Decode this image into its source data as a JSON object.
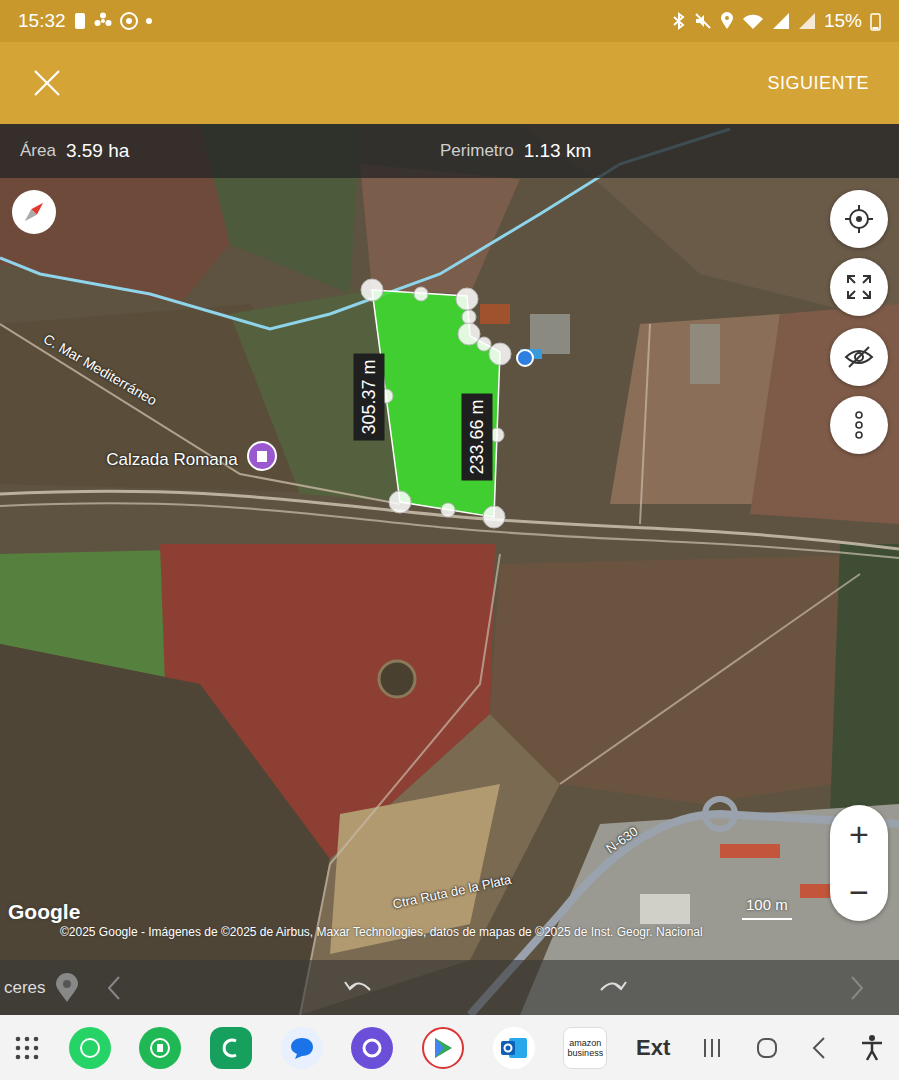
{
  "status_bar": {
    "time": "15:32",
    "battery": "15%"
  },
  "header": {
    "action": "SIGUIENTE"
  },
  "measure": {
    "area_label": "Área",
    "area_value": "3.59 ha",
    "perimeter_label": "Perimetro",
    "perimeter_value": "1.13 km"
  },
  "polygon": {
    "segments": [
      {
        "length": "305.37 m"
      },
      {
        "length": "233.66 m"
      }
    ]
  },
  "map_labels": [
    {
      "text": "C. Mar Mediterráneo"
    },
    {
      "text": "Calzada Romana"
    },
    {
      "text": "N-630"
    },
    {
      "text": "Ctra Ruta de la Plata"
    }
  ],
  "map_controls": {
    "zoom_in": "+",
    "zoom_out": "−"
  },
  "scale": "100 m",
  "google_logo": "Google",
  "attribution": "©2025 Google - Imágenes de ©2025 de Airbus, Maxar Technologies, datos de mapas de ©2025 de Inst. Geogr. Nacional",
  "toolbar": {
    "place": "ceres"
  },
  "nav_bar": {
    "amazon_label": "amazon business",
    "ext_label": "Ext"
  }
}
